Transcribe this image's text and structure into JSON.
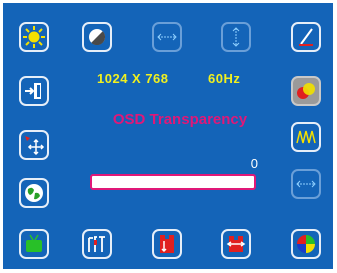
{
  "osd": {
    "resolution": "1024  X  768",
    "refresh": "60Hz",
    "setting_title": "OSD Transparency",
    "value": "0",
    "level_fraction": 0,
    "colors": {
      "background": "#1464b8",
      "info_text": "#f0f020",
      "title_text": "#e01878",
      "selected": "#9a9a9a"
    },
    "icons": [
      "brightness-icon",
      "contrast-icon",
      "h-position-icon",
      "v-position-icon",
      "pen-icon",
      "exit-icon",
      "color-icon",
      "move-menu-icon",
      "phase-icon",
      "language-icon",
      "h-size-icon",
      "recall-icon",
      "tools-icon",
      "reset-icon",
      "swap-icon",
      "color-temperature-icon"
    ]
  }
}
